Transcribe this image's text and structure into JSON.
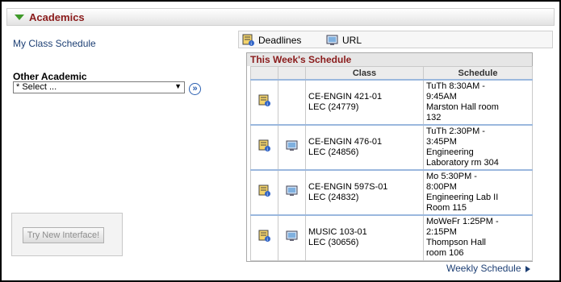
{
  "section": {
    "title": "Academics"
  },
  "left": {
    "my_class_schedule": "My Class Schedule",
    "other_academic_label": "Other Academic",
    "select_value": "* Select ...",
    "try_new_interface": "Try New Interface!"
  },
  "toolbar": {
    "deadlines": "Deadlines",
    "url": "URL"
  },
  "schedule": {
    "title": "This Week's Schedule",
    "col_class": "Class",
    "col_schedule": "Schedule",
    "rows": [
      {
        "class_line1": "CE-ENGIN 421-01",
        "class_line2": "LEC (24779)",
        "sched": [
          "TuTh 8:30AM -",
          "9:45AM",
          "Marston Hall room",
          "132"
        ]
      },
      {
        "class_line1": "CE-ENGIN 476-01",
        "class_line2": "LEC (24856)",
        "sched": [
          "TuTh 2:30PM -",
          "3:45PM",
          "Engineering",
          "Laboratory rm 304"
        ]
      },
      {
        "class_line1": "CE-ENGIN 597S-01",
        "class_line2": "LEC (24832)",
        "sched": [
          "Mo 5:30PM -",
          "8:00PM",
          "Engineering Lab II",
          "Room 115"
        ]
      },
      {
        "class_line1": "MUSIC 103-01",
        "class_line2": "LEC (30656)",
        "sched": [
          "MoWeFr 1:25PM -",
          "2:15PM",
          "Thompson Hall",
          "room 106"
        ]
      }
    ],
    "weekly_link": "Weekly Schedule"
  },
  "colors": {
    "title_red": "#8a1b1b",
    "link_blue": "#1d3f74",
    "accent_green": "#3f9a2a"
  }
}
